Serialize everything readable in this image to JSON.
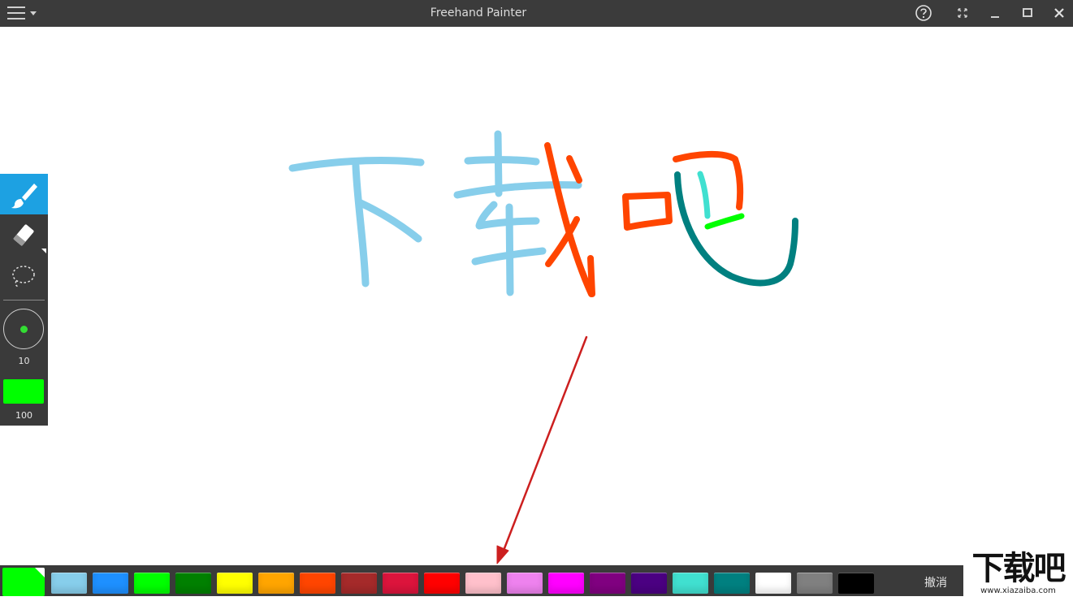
{
  "window": {
    "title": "Freehand Painter"
  },
  "toolbox": {
    "brush_size": "10",
    "opacity": "100",
    "current_color": "#00ff00",
    "active_tool": "brush"
  },
  "palette": {
    "active_color": "#00ff00",
    "colors": [
      "#87ceeb",
      "#1e90ff",
      "#00ff00",
      "#008000",
      "#ffff00",
      "#ffa500",
      "#ff4500",
      "#a52a2a",
      "#dc143c",
      "#ff0000",
      "#ffc0cb",
      "#ee82ee",
      "#ff00ff",
      "#800080",
      "#4b0082",
      "#40e0d0",
      "#008080",
      "#ffffff",
      "#808080",
      "#000000"
    ],
    "undo_label": "撤消"
  },
  "watermark": {
    "text": "下载吧",
    "url": "www.xiazaiba.com"
  },
  "drawing": {
    "stroke_colors": {
      "light_blue": "#87ceeb",
      "orange_red": "#ff4500",
      "teal": "#008080",
      "turquoise": "#40e0d0",
      "green": "#00ff00",
      "annotation": "#cc1f1f"
    }
  }
}
